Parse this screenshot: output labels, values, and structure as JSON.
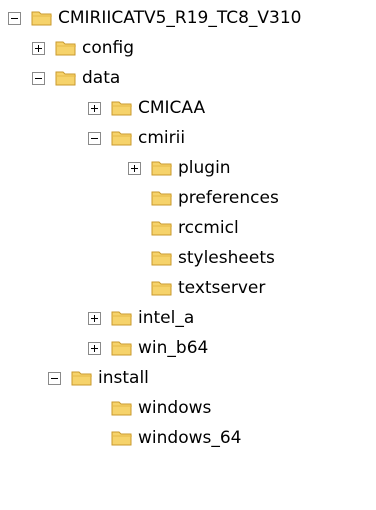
{
  "tree": {
    "nodes": [
      {
        "label": "CMIRIICATV5_R19_TC8_V310",
        "toggle": "minus"
      },
      {
        "label": "config",
        "toggle": "plus"
      },
      {
        "label": "data",
        "toggle": "minus"
      },
      {
        "label": "CMICAA",
        "toggle": "plus"
      },
      {
        "label": "cmirii",
        "toggle": "minus"
      },
      {
        "label": "plugin",
        "toggle": "plus"
      },
      {
        "label": "preferences",
        "toggle": "none"
      },
      {
        "label": "rccmicl",
        "toggle": "none"
      },
      {
        "label": "stylesheets",
        "toggle": "none"
      },
      {
        "label": "textserver",
        "toggle": "none"
      },
      {
        "label": "intel_a",
        "toggle": "plus"
      },
      {
        "label": "win_b64",
        "toggle": "plus"
      },
      {
        "label": "install",
        "toggle": "minus"
      },
      {
        "label": "windows",
        "toggle": "none"
      },
      {
        "label": "windows_64",
        "toggle": "none"
      }
    ]
  },
  "colors": {
    "folder_fill": "#f6d36b",
    "folder_stroke": "#c99a2e",
    "toggle_border": "#8a8a8a"
  }
}
